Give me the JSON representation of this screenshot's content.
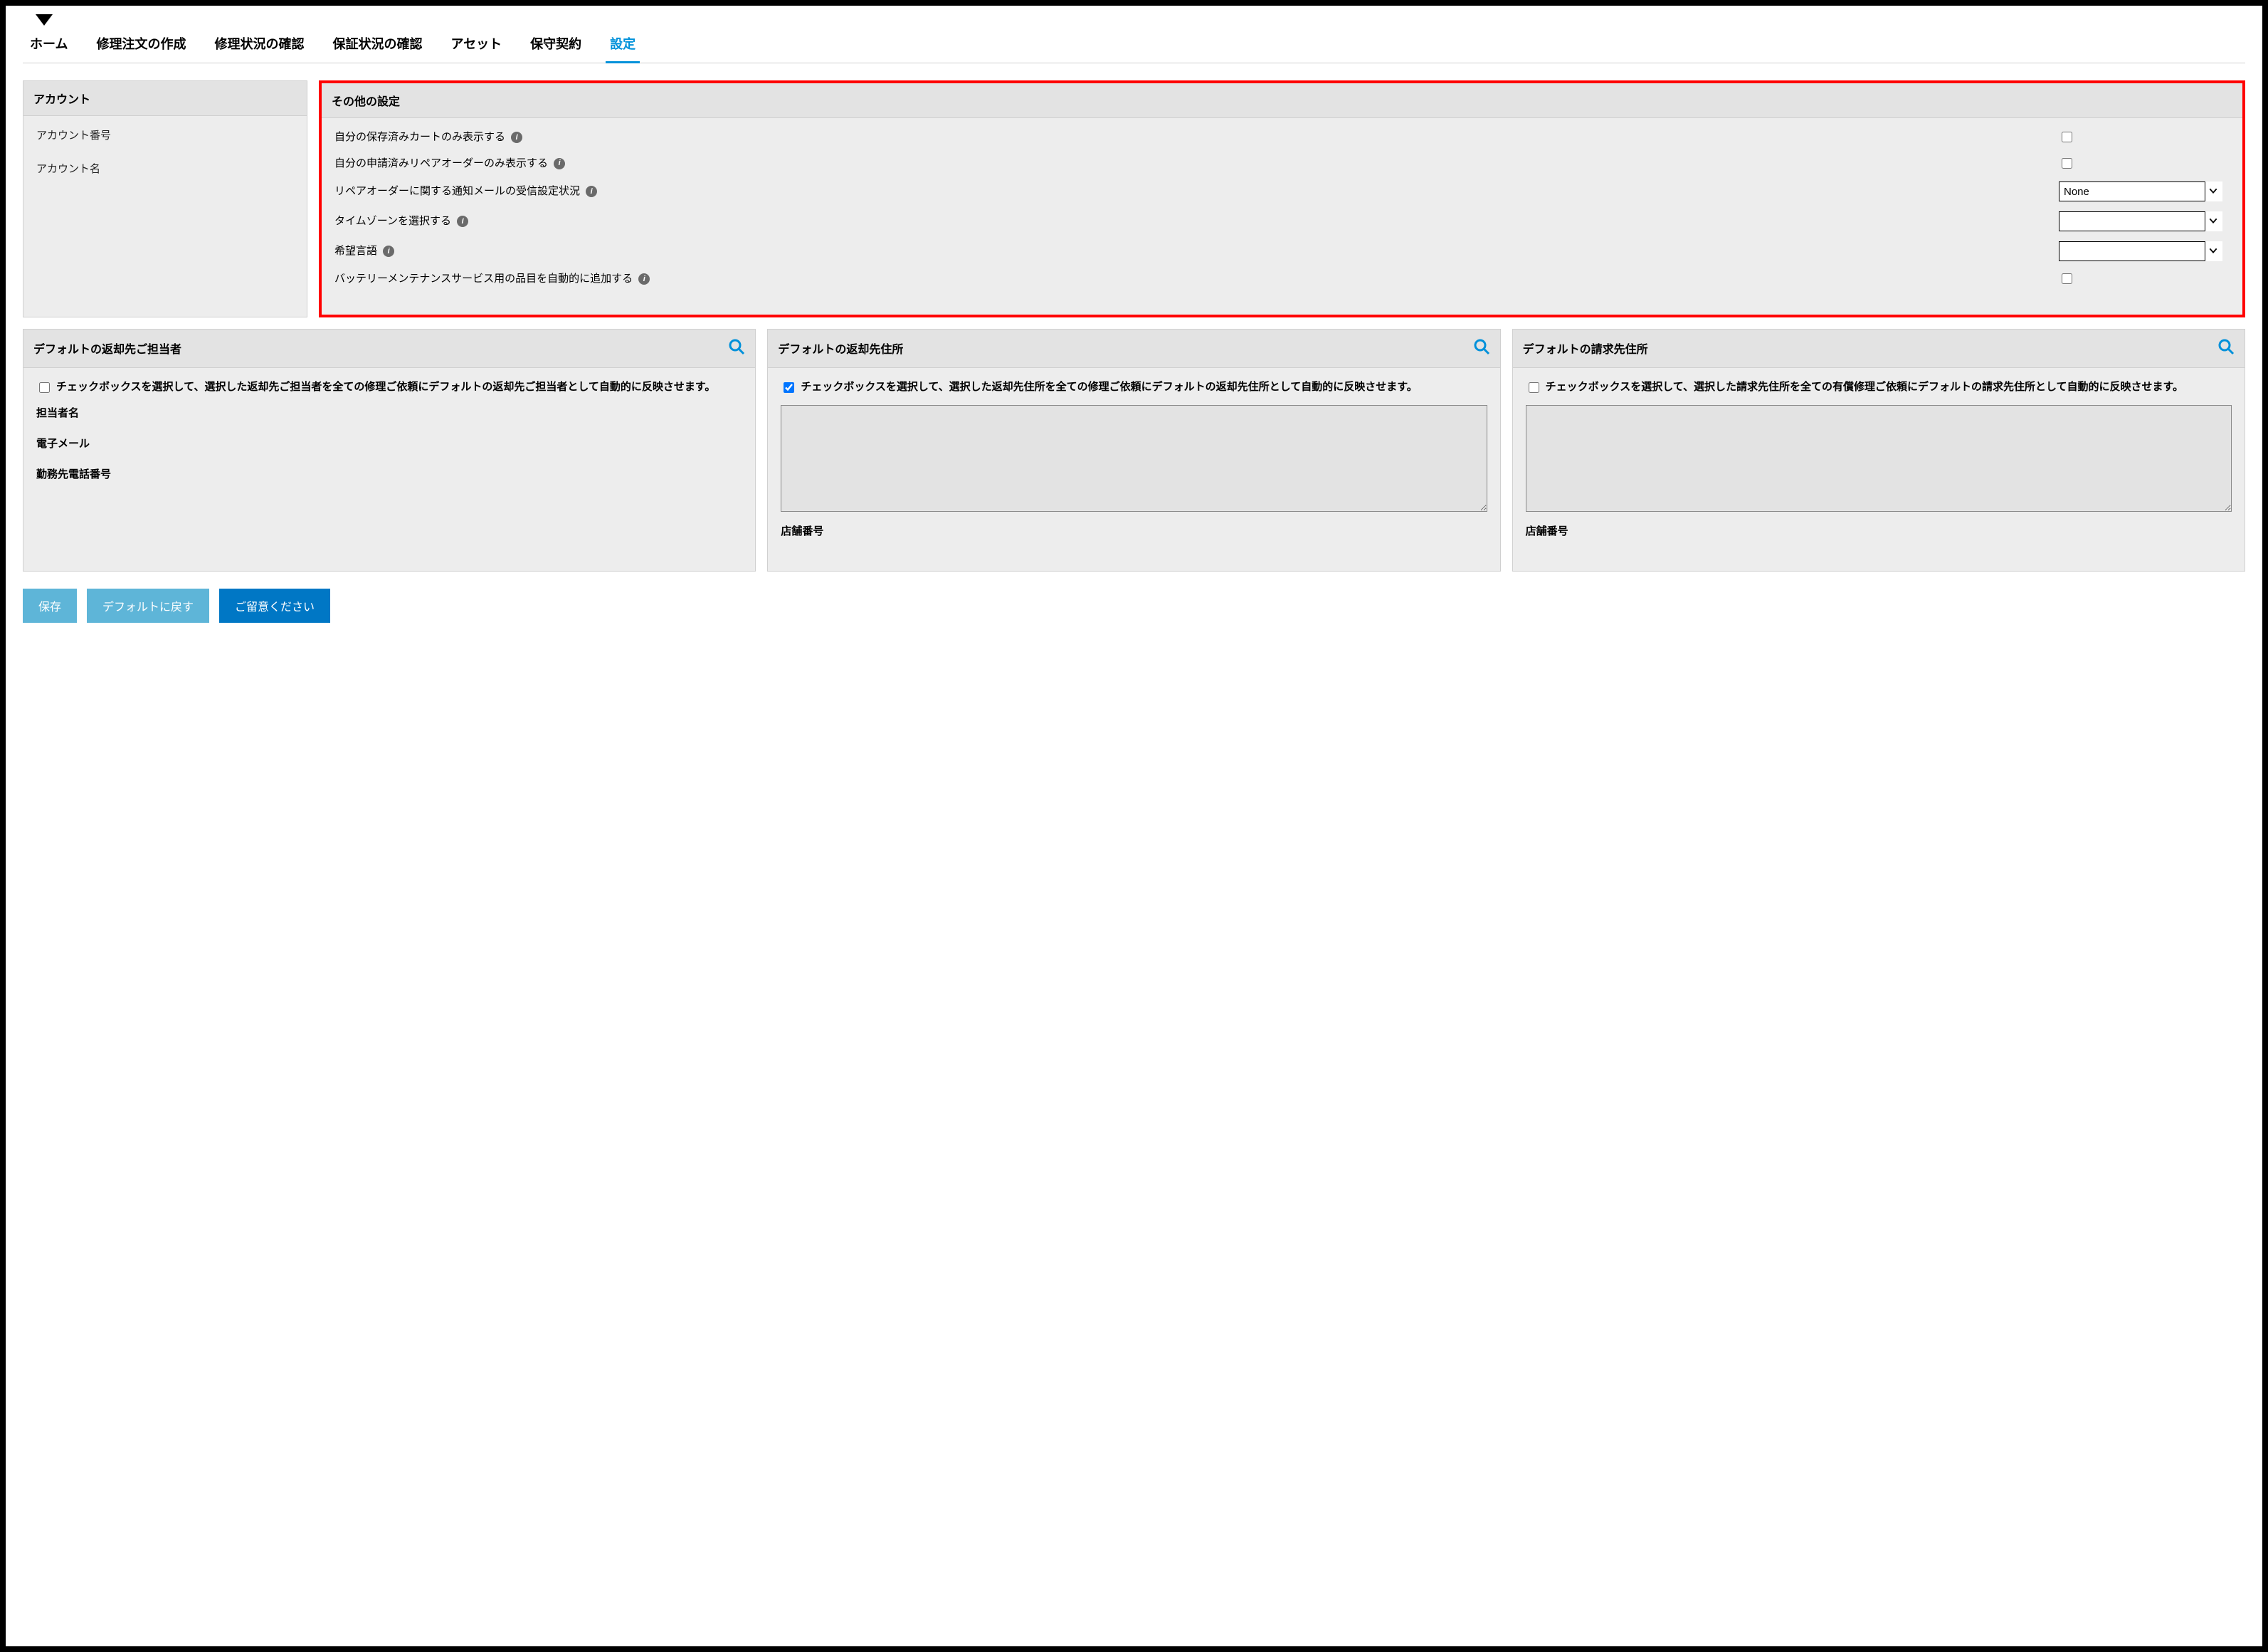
{
  "nav": {
    "tabs": [
      {
        "label": "ホーム"
      },
      {
        "label": "修理注文の作成"
      },
      {
        "label": "修理状況の確認"
      },
      {
        "label": "保証状況の確認"
      },
      {
        "label": "アセット"
      },
      {
        "label": "保守契約"
      },
      {
        "label": "設定"
      }
    ],
    "active_index": 6
  },
  "account_panel": {
    "title": "アカウント",
    "fields": {
      "number_label": "アカウント番号",
      "name_label": "アカウント名"
    }
  },
  "other_settings": {
    "title": "その他の設定",
    "rows": {
      "own_carts": {
        "label": "自分の保存済みカートのみ表示する",
        "checked": false
      },
      "own_orders": {
        "label": "自分の申請済みリペアオーダーのみ表示する",
        "checked": false
      },
      "notify": {
        "label": "リペアオーダーに関する通知メールの受信設定状況",
        "selected": "None"
      },
      "timezone": {
        "label": "タイムゾーンを選択する",
        "selected": ""
      },
      "language": {
        "label": "希望言語",
        "selected": ""
      },
      "battery": {
        "label": "バッテリーメンテナンスサービス用の品目を自動的に追加する",
        "checked": false
      }
    }
  },
  "default_return_contact": {
    "title": "デフォルトの返却先ご担当者",
    "checkbox": {
      "checked": false,
      "text": "チェックボックスを選択して、選択した返却先ご担当者を全ての修理ご依頼にデフォルトの返却先ご担当者として自動的に反映させます。"
    },
    "fields": {
      "contact_name": "担当者名",
      "email": "電子メール",
      "work_phone": "勤務先電話番号"
    }
  },
  "default_return_address": {
    "title": "デフォルトの返却先住所",
    "checkbox": {
      "checked": true,
      "text": "チェックボックスを選択して、選択した返却先住所を全ての修理ご依頼にデフォルトの返却先住所として自動的に反映させます。"
    },
    "store_number_label": "店舗番号",
    "address_text": ""
  },
  "default_billing_address": {
    "title": "デフォルトの請求先住所",
    "checkbox": {
      "checked": false,
      "text": "チェックボックスを選択して、選択した請求先住所を全ての有償修理ご依頼にデフォルトの請求先住所として自動的に反映させます。"
    },
    "store_number_label": "店舗番号",
    "address_text": ""
  },
  "actions": {
    "save": "保存",
    "reset": "デフォルトに戻す",
    "note": "ご留意ください"
  },
  "colors": {
    "accent": "#0091da",
    "highlight_border": "#ff0000"
  }
}
